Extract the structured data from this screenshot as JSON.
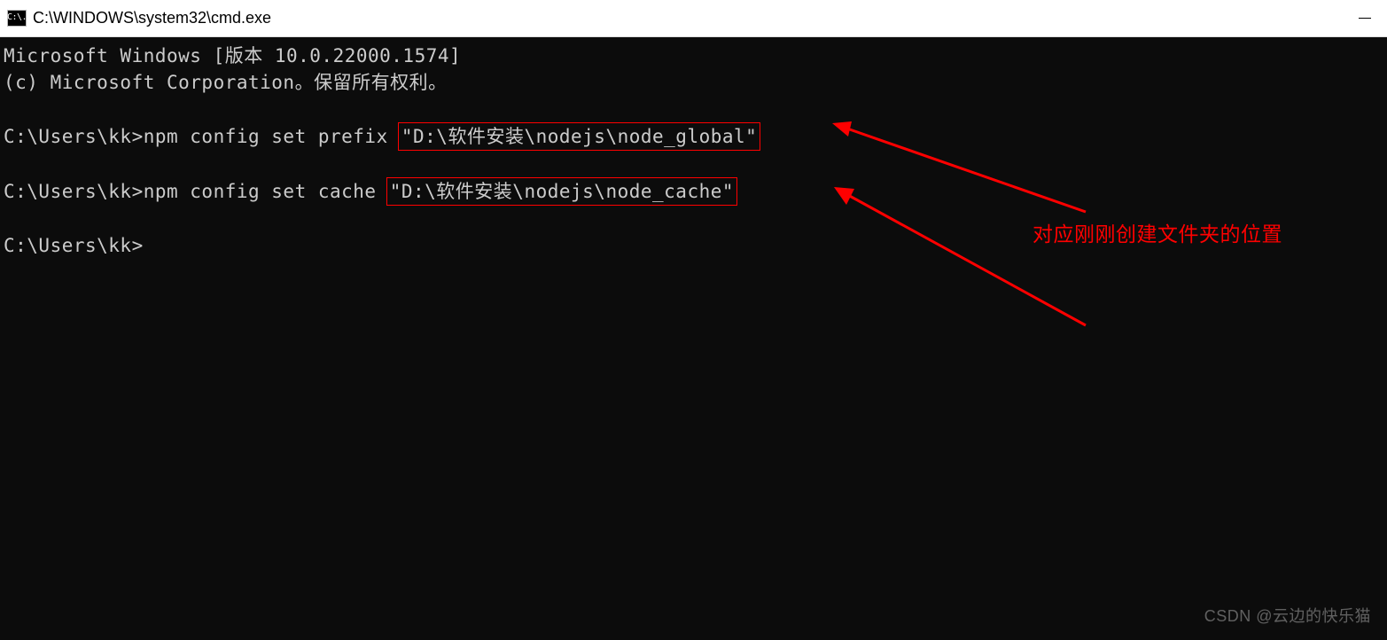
{
  "window": {
    "icon_text": "C:\\.",
    "title": "C:\\WINDOWS\\system32\\cmd.exe"
  },
  "terminal": {
    "line1": "Microsoft Windows [版本 10.0.22000.1574]",
    "line2": "(c) Microsoft Corporation。保留所有权利。",
    "cmd1_prompt": "C:\\Users\\kk>npm config set prefix ",
    "cmd1_highlight": "\"D:\\软件安装\\nodejs\\node_global\"",
    "cmd2_prompt": "C:\\Users\\kk>npm config set cache ",
    "cmd2_highlight": "\"D:\\软件安装\\nodejs\\node_cache\"",
    "cmd3_prompt": "C:\\Users\\kk>"
  },
  "annotation": {
    "label": "对应刚刚创建文件夹的位置"
  },
  "watermark": "CSDN @云边的快乐猫",
  "colors": {
    "highlight": "#ff0000",
    "terminal_bg": "#0c0c0c",
    "terminal_fg": "#cccccc"
  }
}
